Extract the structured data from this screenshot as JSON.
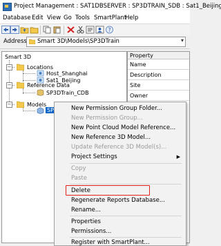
{
  "window": {
    "title": "Project Management : SAT1DBSERVER : SP3DTRAIN_SDB : Sat1_Beijing"
  },
  "menubar": {
    "items": [
      "Database",
      "Edit",
      "View",
      "Go",
      "Tools",
      "SmartPlant",
      "Help"
    ]
  },
  "toolbar": {
    "icons": [
      "back-icon",
      "forward-icon",
      "up-folder-icon",
      "open-folder-icon",
      "copy-icon",
      "paste-icon",
      "delete-icon",
      "cut-icon",
      "properties-icon",
      "permissions-icon",
      "help-icon"
    ]
  },
  "address": {
    "label": "Address",
    "value": "Smart 3D\\Models\\SP3DTrain"
  },
  "tree": {
    "root": "Smart 3D",
    "locations": {
      "label": "Locations",
      "children": [
        "Host_Shanghai",
        "Sat1_Beijing"
      ]
    },
    "reference_data": {
      "label": "Reference Data",
      "children": [
        "SP3DTrain_CDB"
      ]
    },
    "models": {
      "label": "Models",
      "children": [
        "SP3"
      ]
    }
  },
  "properties": {
    "header": "Property",
    "rows": [
      "Name",
      "Description",
      "Site",
      "Owner"
    ]
  },
  "context_menu": {
    "items": [
      {
        "label": "New Permission Group Folder...",
        "enabled": true
      },
      {
        "label": "New Permission Group...",
        "enabled": false
      },
      {
        "label": "New Point Cloud Model Reference...",
        "enabled": true
      },
      {
        "label": "New Reference 3D Model...",
        "enabled": true
      },
      {
        "label": "Update Reference 3D Model(s)...",
        "enabled": false
      },
      {
        "label": "Project Settings",
        "enabled": true,
        "submenu": true
      },
      {
        "label": "Copy",
        "enabled": false
      },
      {
        "label": "Paste",
        "enabled": false
      },
      {
        "label": "Delete",
        "enabled": true
      },
      {
        "label": "Regenerate Reports Database...",
        "enabled": true,
        "highlighted": true
      },
      {
        "label": "Rename...",
        "enabled": true
      },
      {
        "label": "Properties",
        "enabled": true
      },
      {
        "label": "Permissions...",
        "enabled": true
      },
      {
        "label": "Register with SmartPlant...",
        "enabled": true
      }
    ]
  },
  "colors": {
    "selection": "#0a64c8",
    "highlight": "#e0201b"
  }
}
